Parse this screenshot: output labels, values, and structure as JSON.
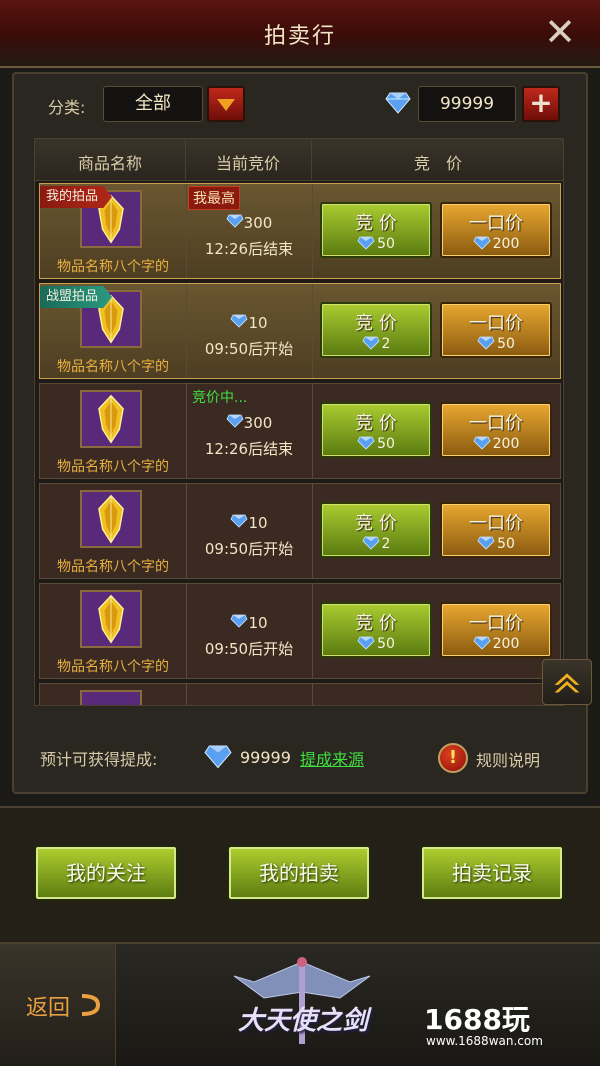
{
  "header": {
    "title": "拍卖行",
    "close_icon": "close-icon"
  },
  "filter": {
    "label": "分类:",
    "selected": "全部"
  },
  "currency": {
    "amount": "99999"
  },
  "table": {
    "headers": [
      "商品名称",
      "当前竞价",
      "竞　价"
    ],
    "rows": [
      {
        "tag": "我的拍品",
        "tag_color": "red",
        "status": "我最高",
        "status_color": "red",
        "price": "300",
        "time": "12:26后结束",
        "item_name": "物品名称八个字的",
        "bid_label": "竞 价",
        "bid_value": "50",
        "buy_label": "一口价",
        "buy_value": "200",
        "highlight": true
      },
      {
        "tag": "战盟拍品",
        "tag_color": "green",
        "status": "",
        "status_color": "",
        "price": "10",
        "time": "09:50后开始",
        "item_name": "物品名称八个字的",
        "bid_label": "竞 价",
        "bid_value": "2",
        "buy_label": "一口价",
        "buy_value": "50",
        "highlight": true
      },
      {
        "tag": "",
        "tag_color": "",
        "status": "竞价中...",
        "status_color": "green",
        "price": "300",
        "time": "12:26后结束",
        "item_name": "物品名称八个字的",
        "bid_label": "竞 价",
        "bid_value": "50",
        "buy_label": "一口价",
        "buy_value": "200",
        "highlight": false
      },
      {
        "tag": "",
        "tag_color": "",
        "status": "",
        "status_color": "",
        "price": "10",
        "time": "09:50后开始",
        "item_name": "物品名称八个字的",
        "bid_label": "竞 价",
        "bid_value": "2",
        "buy_label": "一口价",
        "buy_value": "50",
        "highlight": false
      },
      {
        "tag": "",
        "tag_color": "",
        "status": "",
        "status_color": "",
        "price": "10",
        "time": "09:50后开始",
        "item_name": "物品名称八个字的",
        "bid_label": "竞 价",
        "bid_value": "50",
        "buy_label": "一口价",
        "buy_value": "200",
        "highlight": false
      }
    ]
  },
  "commission": {
    "label": "预计可获得提成:",
    "value": "99999",
    "link": "提成来源"
  },
  "rules": {
    "label": "规则说明"
  },
  "actions": {
    "watch": "我的关注",
    "my_auctions": "我的拍卖",
    "records": "拍卖记录"
  },
  "footer": {
    "back": "返回",
    "logo_text": "大天使之剑",
    "watermark": "1688玩",
    "watermark_url": "www.1688wan.com"
  },
  "colors": {
    "accent_green": "#40e040",
    "gold": "#e8b040",
    "title_red": "#5a1410"
  }
}
